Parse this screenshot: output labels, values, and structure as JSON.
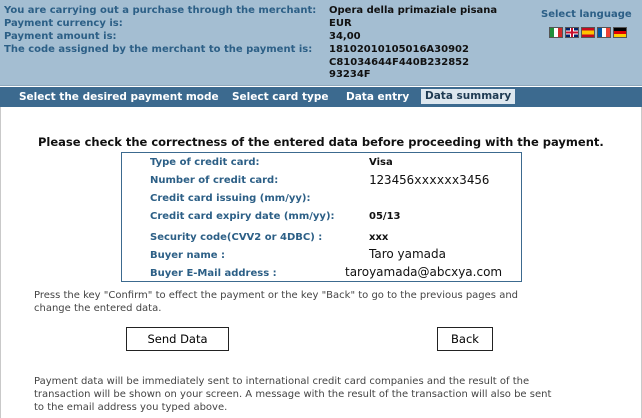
{
  "header": {
    "rows": [
      {
        "label": "You are carrying out a purchase through the merchant:",
        "value": "Opera della primaziale pisana"
      },
      {
        "label": "Payment currency is:",
        "value": "EUR"
      },
      {
        "label": "Payment amount is:",
        "value": "34,00"
      },
      {
        "label": "The code assigned by the merchant to the payment is:",
        "value": "18102010105016A30902"
      }
    ],
    "code_line2": "C81034644F440B232852",
    "code_line3": "93234F",
    "language_label": "Select language",
    "flags": [
      "flag-italian-icon",
      "flag-english-icon",
      "flag-spanish-icon",
      "flag-french-icon",
      "flag-german-icon"
    ]
  },
  "nav": {
    "steps": [
      "Select the desired payment mode",
      "Select card type",
      "Data entry",
      "Data summary"
    ],
    "active": "Data summary"
  },
  "main": {
    "instruction": "Please check the correctness of the entered data before proceeding with the payment.",
    "summary": [
      {
        "label": "Type of credit card:",
        "value": "Visa"
      },
      {
        "label": "Number of credit card:",
        "value": "123456xxxxxx3456"
      },
      {
        "label": "Credit card issuing (mm/yy):",
        "value": ""
      },
      {
        "label": "Credit card expiry date (mm/yy):",
        "value": "05/13"
      },
      {
        "label": "Security code(CVV2 or 4DBC) :",
        "value": "xxx"
      },
      {
        "label": "Buyer name :",
        "value": "Taro yamada"
      },
      {
        "label": "Buyer E-Mail address :",
        "value": "taroyamada@abcxya.com"
      }
    ],
    "confirm_info_1": "Press the key \"Confirm\" to effect the payment or the key \"Back\" to go to the previous pages and",
    "confirm_info_2": "change the entered data.",
    "send_button": "Send Data",
    "back_button": "Back",
    "footer_1": "Payment data will be immediately sent to international credit card companies and the result of the",
    "footer_2": "transaction will be shown on your screen. A message with the result of the transaction will also be sent",
    "footer_3": "to the email address you typed above."
  },
  "colors": {
    "header_bg": "#a4bed2",
    "label_blue": "#2c5f86",
    "nav_bg": "#3c6a8f",
    "active_tab_bg": "#dde7ef"
  }
}
